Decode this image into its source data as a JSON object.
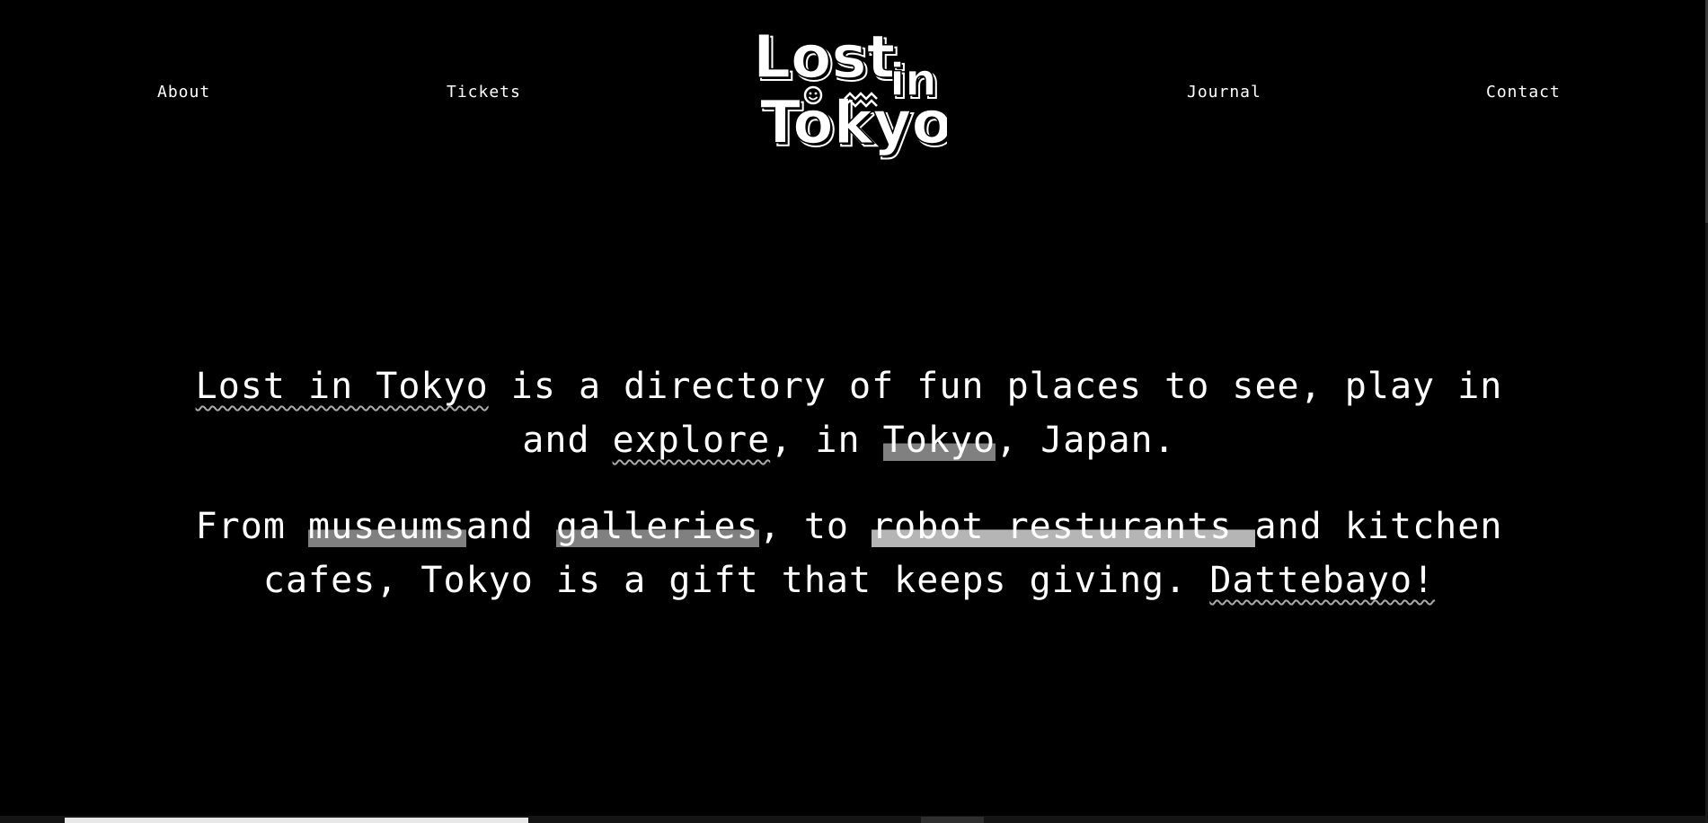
{
  "nav": {
    "about": "About",
    "tickets": "Tickets",
    "journal": "Journal",
    "contact": "Contact"
  },
  "logo": {
    "line1": "Lost",
    "line1b": "in",
    "line2": "Tokyo"
  },
  "intro": {
    "p1": {
      "brand": "Lost in Tokyo",
      "t1": " is a directory of fun places to see, play in and ",
      "explore": "explore",
      "t2": ", in ",
      "tokyo": "Tokyo",
      "t3": ", Japan."
    },
    "p2": {
      "t1": "From ",
      "museums": "museums",
      "t2": "and ",
      "galleries": "galleries",
      "t3": ", to ",
      "robot": "robot resturants ",
      "t4": "and kitchen cafes, Tokyo is a gift that keeps giving. ",
      "dattebayo": "Dattebayo!"
    }
  },
  "colors": {
    "background": "#000000",
    "text": "#ffffff",
    "highlight_dark": "#808080",
    "highlight_light": "#b5b5b5",
    "wavy_underline": "#aaaaaa"
  },
  "page_progress_fraction": 0.28
}
